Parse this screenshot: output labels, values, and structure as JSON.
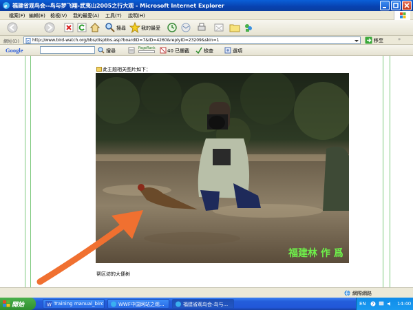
{
  "window": {
    "title": "福建省观鸟会--鸟与梦飞翔-武夷山2005之行大观 - Microsoft Internet Explorer"
  },
  "menu": [
    "檔案(F)",
    "編輯(E)",
    "檢視(V)",
    "我的最愛(A)",
    "工具(T)",
    "說明(H)"
  ],
  "toolbar": {
    "search_label": "搜尋",
    "favorites_label": "我的最愛"
  },
  "address": {
    "label": "網址(D)",
    "url": "http://www.bird-watch.org/bbs/dispbbs.asp?boardID=7&ID=4260&replyID=23209&skin=1",
    "go_label": "移至"
  },
  "google_bar": {
    "logo": "Google",
    "search_label": "搜尋",
    "pagerank_label": "PageRank",
    "blocked_label": "40 已攔截",
    "check_label": "檢查",
    "options_label": "選項"
  },
  "content": {
    "caption_top": "此主题相关图片如下：",
    "photo_watermark": "福建林  作  爲",
    "caption_bottom": "帮区坊的大便树"
  },
  "status": {
    "zone_label": "網際網路"
  },
  "taskbar": {
    "start_label": "開始",
    "tasks": [
      {
        "label": "Training manual_bird ..."
      },
      {
        "label": "WWF中国网站之观..."
      },
      {
        "label": "福建省观鸟会-鸟与..."
      }
    ],
    "lang": "EN",
    "clock": "14:40"
  },
  "colors": {
    "titlebar": "#0842b0",
    "taskbar": "#245edb",
    "start": "#3a9a3a",
    "watermark": "#6ef04a",
    "arrow": "#f07030"
  }
}
